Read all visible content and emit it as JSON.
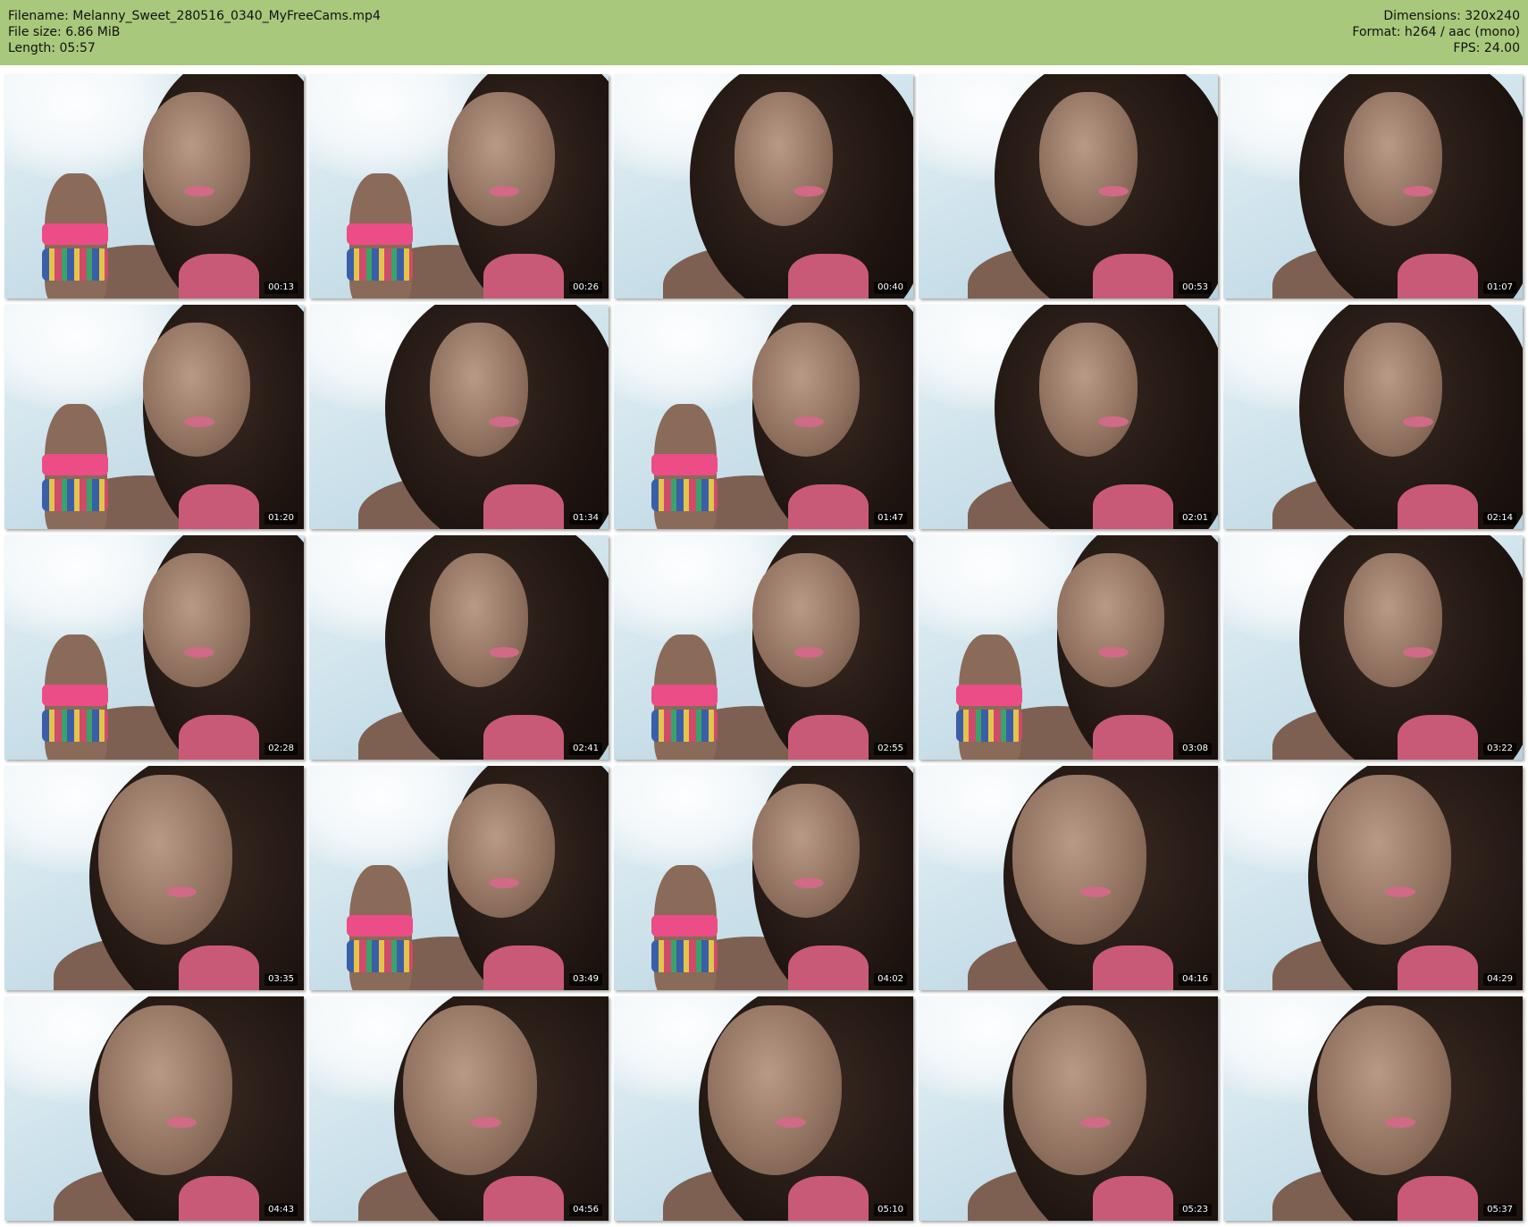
{
  "header": {
    "filename_line": "Filename: Melanny_Sweet_280516_0340_MyFreeCams.mp4",
    "filesize_line": "File size: 6.86 MiB",
    "length_line": "Length: 05:57",
    "dimensions_line": "Dimensions: 320x240",
    "format_line": "Format: h264 / aac (mono)",
    "fps_line": "FPS: 24.00"
  },
  "colors": {
    "header_bg": "#a8c87c",
    "timestamp_bg": "#000000",
    "timestamp_text": "#ffffff"
  },
  "thumbnails": [
    {
      "time": "00:13",
      "variant": "hand"
    },
    {
      "time": "00:26",
      "variant": "hand"
    },
    {
      "time": "00:40",
      "variant": "profile"
    },
    {
      "time": "00:53",
      "variant": "profile"
    },
    {
      "time": "01:07",
      "variant": "profile"
    },
    {
      "time": "01:20",
      "variant": "hand"
    },
    {
      "time": "01:34",
      "variant": "profile"
    },
    {
      "time": "01:47",
      "variant": "hand"
    },
    {
      "time": "02:01",
      "variant": "profile"
    },
    {
      "time": "02:14",
      "variant": "profile"
    },
    {
      "time": "02:28",
      "variant": "hand"
    },
    {
      "time": "02:41",
      "variant": "profile"
    },
    {
      "time": "02:55",
      "variant": "hand"
    },
    {
      "time": "03:08",
      "variant": "hand"
    },
    {
      "time": "03:22",
      "variant": "profile"
    },
    {
      "time": "03:35",
      "variant": "close"
    },
    {
      "time": "03:49",
      "variant": "hand"
    },
    {
      "time": "04:02",
      "variant": "hand"
    },
    {
      "time": "04:16",
      "variant": "close"
    },
    {
      "time": "04:29",
      "variant": "close"
    },
    {
      "time": "04:43",
      "variant": "close"
    },
    {
      "time": "04:56",
      "variant": "close"
    },
    {
      "time": "05:10",
      "variant": "close"
    },
    {
      "time": "05:23",
      "variant": "close"
    },
    {
      "time": "05:37",
      "variant": "close"
    }
  ]
}
